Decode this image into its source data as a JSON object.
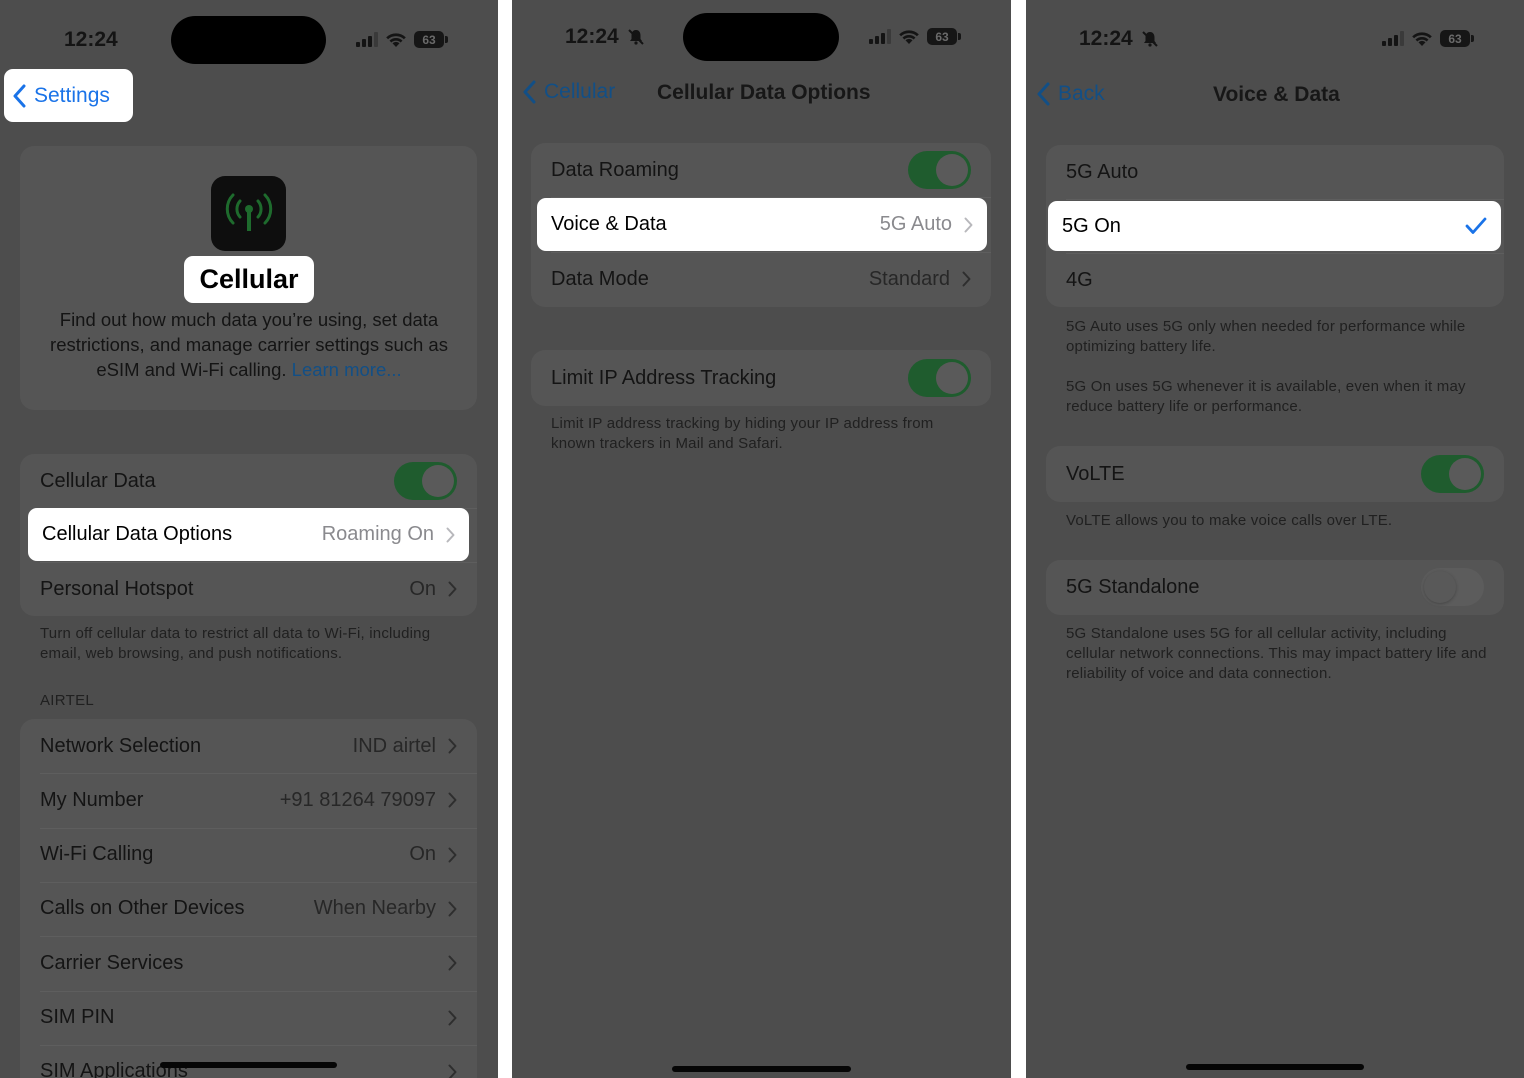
{
  "status_bar": {
    "time": "12:24",
    "battery": "63"
  },
  "screen1": {
    "back_label": "Settings",
    "header_title": "Cellular",
    "description": "Find out how much data you’re using, set data restrictions, and manage carrier settings such as eSIM and Wi-Fi calling.",
    "learn_more": "Learn more...",
    "rows_top": [
      {
        "label": "Cellular Data",
        "toggle": "on"
      },
      {
        "label": "Cellular Data Options",
        "value": "Roaming On"
      },
      {
        "label": "Personal Hotspot",
        "value": "On"
      }
    ],
    "footer_top": "Turn off cellular data to restrict all data to Wi-Fi, including email, web browsing, and push notifications.",
    "carrier_header": "AIRTEL",
    "carrier_rows": [
      {
        "label": "Network Selection",
        "value": "IND airtel"
      },
      {
        "label": "My Number",
        "value": "+91 81264 79097"
      },
      {
        "label": "Wi-Fi Calling",
        "value": "On"
      },
      {
        "label": "Calls on Other Devices",
        "value": "When Nearby"
      },
      {
        "label": "Carrier Services",
        "value": ""
      },
      {
        "label": "SIM PIN",
        "value": ""
      },
      {
        "label": "SIM Applications",
        "value": ""
      }
    ]
  },
  "screen2": {
    "back_label": "Cellular",
    "title": "Cellular Data Options",
    "rows": [
      {
        "label": "Data Roaming",
        "toggle": "on"
      },
      {
        "label": "Voice & Data",
        "value": "5G Auto"
      },
      {
        "label": "Data Mode",
        "value": "Standard"
      }
    ],
    "limit_ip": {
      "label": "Limit IP Address Tracking",
      "toggle": "on"
    },
    "limit_ip_footer": "Limit IP address tracking by hiding your IP address from known trackers in Mail and Safari."
  },
  "screen3": {
    "back_label": "Back",
    "title": "Voice & Data",
    "options": [
      {
        "label": "5G Auto",
        "selected": false
      },
      {
        "label": "5G On",
        "selected": true
      },
      {
        "label": "4G",
        "selected": false
      }
    ],
    "footer_5g_auto": "5G Auto uses 5G only when needed for performance while optimizing battery life.",
    "footer_5g_on": "5G On uses 5G whenever it is available, even when it may reduce battery life or performance.",
    "volte": {
      "label": "VoLTE",
      "toggle": "on"
    },
    "volte_footer": "VoLTE allows you to make voice calls over LTE.",
    "standalone": {
      "label": "5G Standalone",
      "toggle": "off"
    },
    "standalone_footer": "5G Standalone uses 5G for all cellular activity, including cellular network connections. This may impact battery life and reliability of voice and data connection."
  }
}
